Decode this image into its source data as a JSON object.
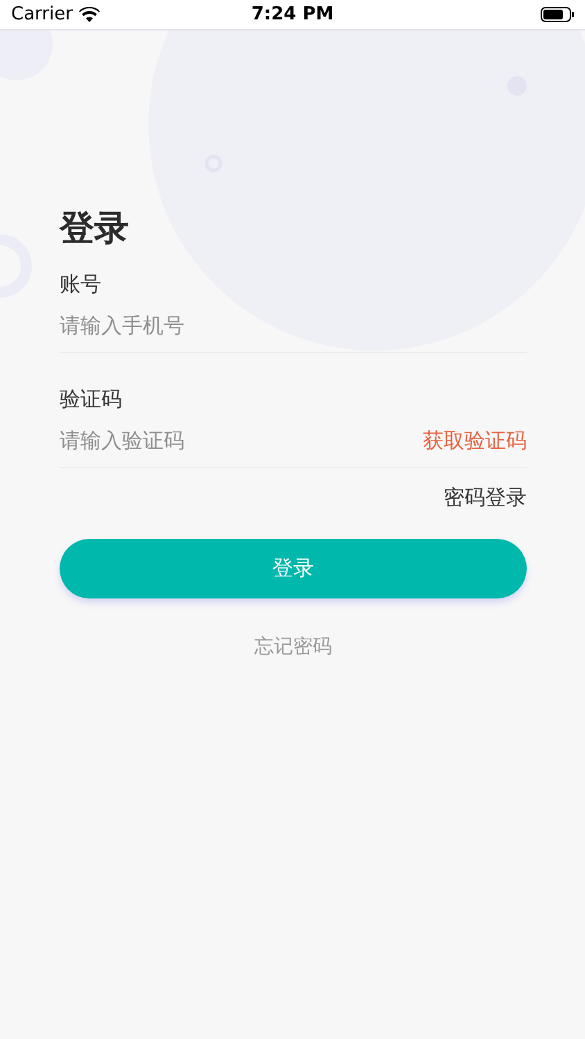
{
  "status_bar": {
    "carrier": "Carrier",
    "time": "7:24 PM"
  },
  "title": "登录",
  "fields": [
    {
      "label": "账号",
      "placeholder": "请输入手机号"
    },
    {
      "label": "验证码",
      "placeholder": "请输入验证码",
      "action": "获取验证码"
    }
  ],
  "switch_link": "密码登录",
  "login_button": "登录",
  "forgot_link": "忘记密码"
}
